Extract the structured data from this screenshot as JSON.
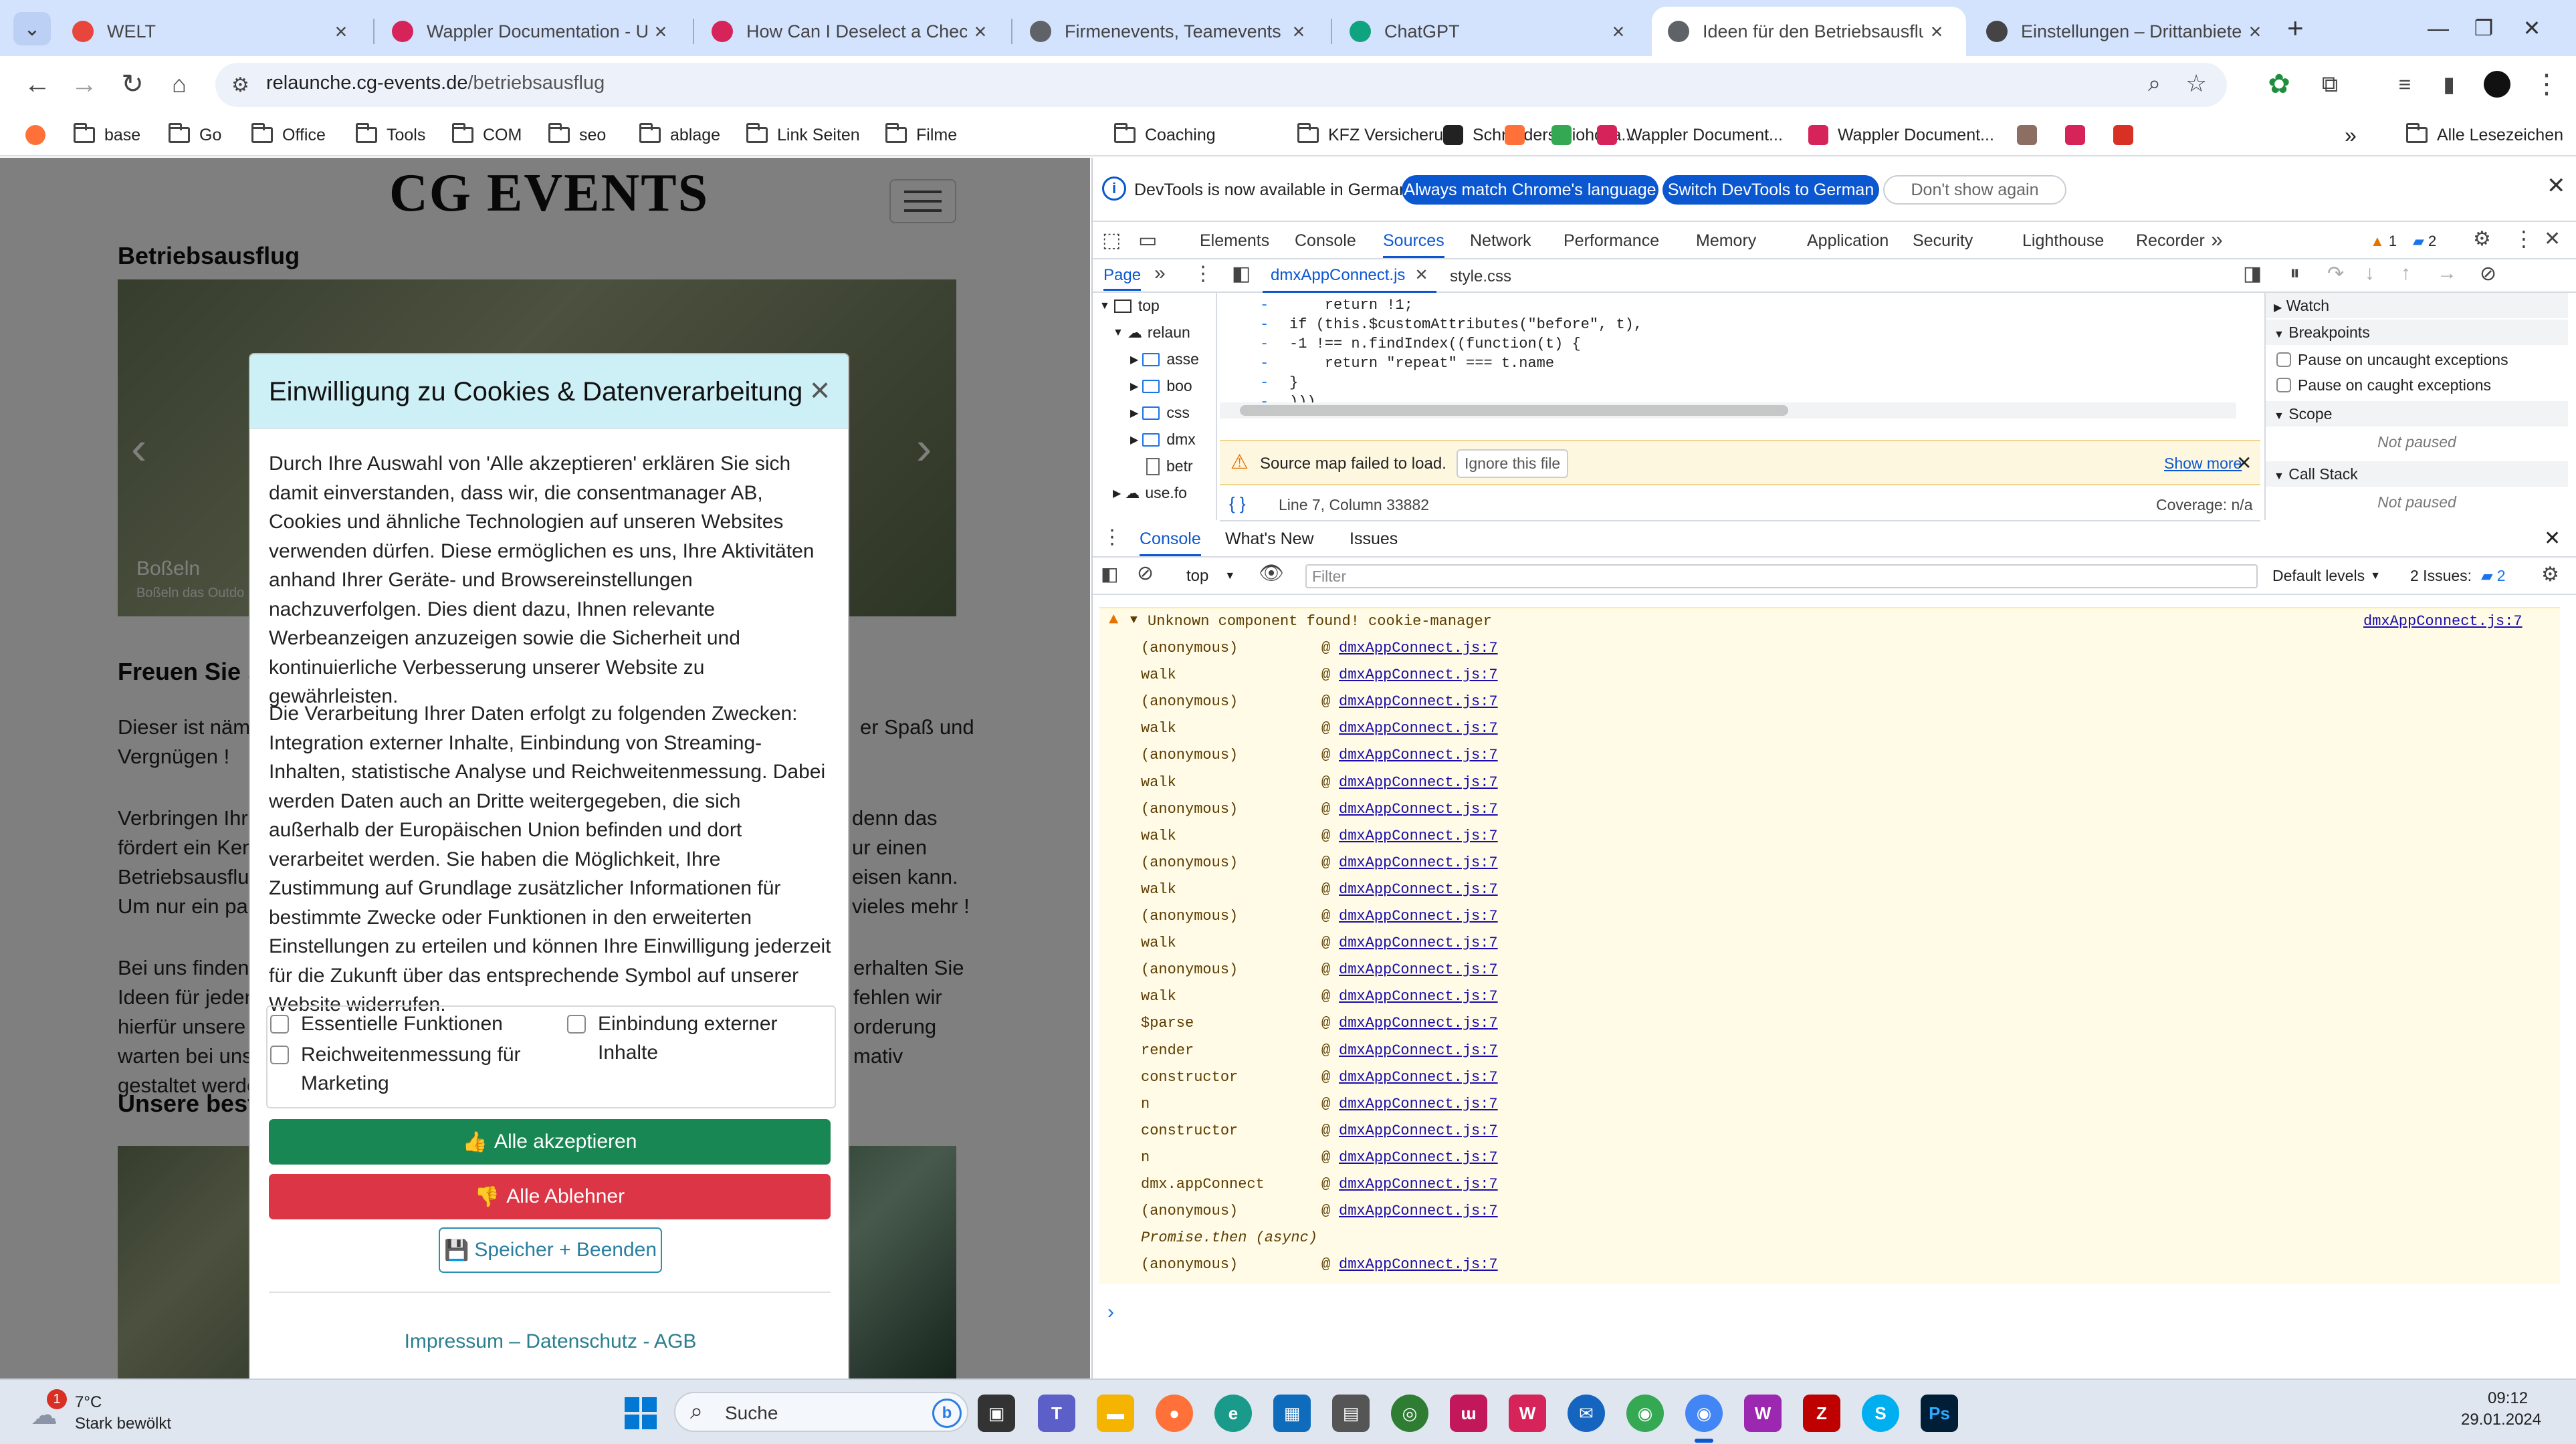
{
  "browser": {
    "tabs": [
      {
        "title": "WELT",
        "color": "#e8453c"
      },
      {
        "title": "Wappler Documentation - Using",
        "color": "#d6245a"
      },
      {
        "title": "How Can I Deselect a Checkbox",
        "color": "#d6245a"
      },
      {
        "title": "Firmenevents, Teamevents und",
        "color": "#5f6368"
      },
      {
        "title": "ChatGPT",
        "color": "#10a37f"
      },
      {
        "title": "Ideen für den Betriebsausflug n",
        "color": "#5f6368"
      },
      {
        "title": "Einstellungen – Drittanbieter-Co",
        "color": "#444444"
      }
    ],
    "active_tab_index": 5,
    "url_host": "relaunche.cg-events.de",
    "url_path": "/betriebsausflug",
    "bookmarks": [
      "base",
      "Go",
      "Office",
      "Tools",
      "COM",
      "seo",
      "ablage",
      "Link Seiten",
      "Filme",
      "Coaching",
      "KFZ Versicherung",
      "Schneiders Biohofla...",
      "Wappler Document...",
      "Wappler Document..."
    ],
    "bookmarks_all": "Alle Lesezeichen"
  },
  "page": {
    "brand": "CG EVENTS",
    "heading1": "Betriebsausflug",
    "slide_caption": "Boßeln",
    "slide_subcaption": "Boßeln das Outdo",
    "heading2": "Freuen Sie s",
    "para1_lines": [
      "Dieser ist nämlic",
      "Vergnügen !"
    ],
    "para1_right": "er Spaß und",
    "para2_lines": [
      "Verbringen Ihre",
      "fördert ein Kenn",
      "Betriebsausflug",
      "Um nur ein pa"
    ],
    "para2_right": [
      "denn das",
      "ur einen",
      "eisen kann.",
      "vieles mehr !"
    ],
    "para3_lines": [
      "Bei uns finden S",
      "Ideen für jeden",
      "hierfür unsere H",
      "warten bei uns",
      "gestaltet werde"
    ],
    "para3_right": [
      "erhalten Sie",
      "fehlen wir",
      "orderung",
      "mativ"
    ],
    "heading3": "Unsere best"
  },
  "cookie_modal": {
    "title": "Einwilligung zu Cookies & Datenverarbeitung",
    "paragraph1": "Durch Ihre Auswahl von 'Alle akzeptieren' erklären Sie sich damit einverstanden, dass wir, die consentmanager AB, Cookies und ähnliche Technologien auf unseren Websites verwenden dürfen. Diese ermöglichen es uns, Ihre Aktivitäten anhand Ihrer Geräte- und Browsereinstellungen nachzuverfolgen. Dies dient dazu, Ihnen relevante Werbeanzeigen anzuzeigen sowie die Sicherheit und kontinuierliche Verbesserung unserer Website zu gewährleisten.",
    "paragraph2": "Die Verarbeitung Ihrer Daten erfolgt zu folgenden Zwecken: Integration externer Inhalte, Einbindung von Streaming-Inhalten, statistische Analyse und Reichweitenmessung. Dabei werden Daten auch an Dritte weitergegeben, die sich außerhalb der Europäischen Union befinden und dort verarbeitet werden. Sie haben die Möglichkeit, Ihre Zustimmung auf Grundlage zusätzlicher Informationen für bestimmte Zwecke oder Funktionen in den erweiterten Einstellungen zu erteilen und können Ihre Einwilligung jederzeit für die Zukunft über das entsprechende Symbol auf unserer Website widerrufen.",
    "checkboxes": [
      "Essentielle Funktionen",
      "Einbindung externer Inhalte",
      "Reichweitenmessung für Marketing"
    ],
    "accept_all": "Alle akzeptieren",
    "reject_all": "Alle Ablehner",
    "save": "Speicher + Beenden",
    "footer_links": "Impressum – Datenschutz - AGB",
    "accept_color": "#198754",
    "reject_color": "#dc3545"
  },
  "devtools": {
    "infobar_text": "DevTools is now available in German!",
    "infobar_btn1": "Always match Chrome's language",
    "infobar_btn2": "Switch DevTools to German",
    "infobar_btn3": "Don't show again",
    "tabs": [
      "Elements",
      "Console",
      "Sources",
      "Network",
      "Performance",
      "Memory",
      "Application",
      "Security",
      "Lighthouse",
      "Recorder"
    ],
    "active_tab": "Sources",
    "warn_count": "1",
    "msg_count": "2",
    "navigator_tab": "Page",
    "open_files": [
      "dmxAppConnect.js",
      "style.css"
    ],
    "tree": [
      "top",
      "relaun",
      "asse",
      "boo",
      "css",
      "dmx",
      "betr",
      "use.fo"
    ],
    "code_lines": [
      "    return !1;",
      "if (this.$customAttributes(\"before\", t),",
      "-1 !== n.findIndex((function(t) {",
      "    return \"repeat\" === t.name",
      "}",
      ")))"
    ],
    "warn_text": "Source map failed to load.",
    "ignore_btn": "Ignore this file",
    "show_more": "Show more",
    "position": "Line 7, Column 33882",
    "coverage": "Coverage: n/a",
    "right_panel": {
      "watch": "Watch",
      "breakpoints": "Breakpoints",
      "pause_uncaught": "Pause on uncaught exceptions",
      "pause_caught": "Pause on caught exceptions",
      "scope": "Scope",
      "not_paused": "Not paused",
      "call_stack": "Call Stack"
    },
    "drawer_tabs": [
      "Console",
      "What's New",
      "Issues"
    ],
    "context": "top",
    "filter_placeholder": "Filter",
    "levels": "Default levels",
    "issues": "2 Issues:",
    "issues_count": "2",
    "console_message": "Unknown component found! cookie-manager",
    "console_source": "dmxAppConnect.js:7",
    "stack": [
      {
        "fn": "(anonymous)",
        "src": "dmxAppConnect.js:7"
      },
      {
        "fn": "walk",
        "src": "dmxAppConnect.js:7"
      },
      {
        "fn": "(anonymous)",
        "src": "dmxAppConnect.js:7"
      },
      {
        "fn": "walk",
        "src": "dmxAppConnect.js:7"
      },
      {
        "fn": "(anonymous)",
        "src": "dmxAppConnect.js:7"
      },
      {
        "fn": "walk",
        "src": "dmxAppConnect.js:7"
      },
      {
        "fn": "(anonymous)",
        "src": "dmxAppConnect.js:7"
      },
      {
        "fn": "walk",
        "src": "dmxAppConnect.js:7"
      },
      {
        "fn": "(anonymous)",
        "src": "dmxAppConnect.js:7"
      },
      {
        "fn": "walk",
        "src": "dmxAppConnect.js:7"
      },
      {
        "fn": "(anonymous)",
        "src": "dmxAppConnect.js:7"
      },
      {
        "fn": "walk",
        "src": "dmxAppConnect.js:7"
      },
      {
        "fn": "(anonymous)",
        "src": "dmxAppConnect.js:7"
      },
      {
        "fn": "walk",
        "src": "dmxAppConnect.js:7"
      },
      {
        "fn": "$parse",
        "src": "dmxAppConnect.js:7"
      },
      {
        "fn": "render",
        "src": "dmxAppConnect.js:7"
      },
      {
        "fn": "constructor",
        "src": "dmxAppConnect.js:7"
      },
      {
        "fn": "n",
        "src": "dmxAppConnect.js:7"
      },
      {
        "fn": "constructor",
        "src": "dmxAppConnect.js:7"
      },
      {
        "fn": "n",
        "src": "dmxAppConnect.js:7"
      },
      {
        "fn": "dmx.appConnect",
        "src": "dmxAppConnect.js:7"
      },
      {
        "fn": "(anonymous)",
        "src": "dmxAppConnect.js:7"
      },
      {
        "fn": "Promise.then (async)",
        "src": ""
      },
      {
        "fn": "(anonymous)",
        "src": "dmxAppConnect.js:7"
      }
    ]
  },
  "taskbar": {
    "weather_temp": "7°C",
    "weather_desc": "Stark bewölkt",
    "weather_badge": "1",
    "search_placeholder": "Suche",
    "time": "09:12",
    "date": "29.01.2024"
  }
}
